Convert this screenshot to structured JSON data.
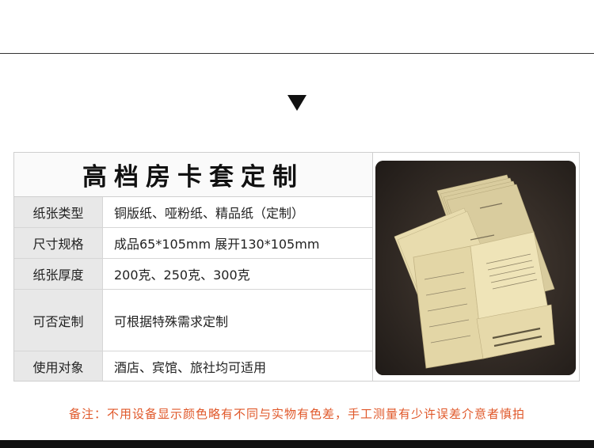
{
  "title": "高档房卡套定制",
  "specs": [
    {
      "label": "纸张类型",
      "value": "铜版纸、哑粉纸、精品纸（定制）"
    },
    {
      "label": "尺寸规格",
      "value": "成品65*105mm  展开130*105mm"
    },
    {
      "label": "纸张厚度",
      "value": "200克、250克、300克"
    },
    {
      "label": "可否定制",
      "value": "可根据特殊需求定制"
    },
    {
      "label": "使用对象",
      "value": "酒店、宾馆、旅社均可适用"
    }
  ],
  "notice": "备注：不用设备显示颜色略有不同与实物有色差，手工测量有少许误差介意者慎拍",
  "colors": {
    "notice": "#e0582a",
    "label_bg": "#e8e8e8",
    "border": "#cfcfcf",
    "photo_bg": "#2a2420",
    "card": "#efe4b8"
  }
}
